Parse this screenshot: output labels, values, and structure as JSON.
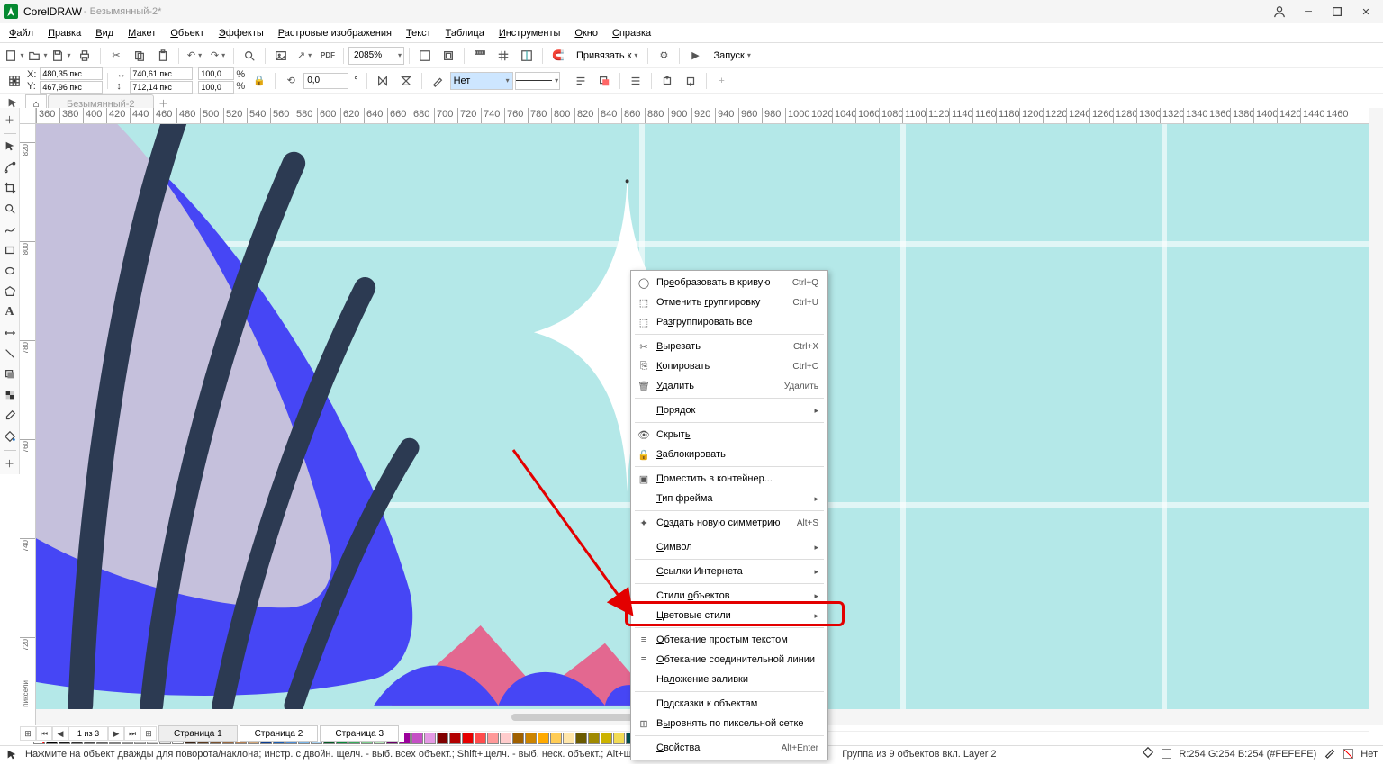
{
  "title": {
    "app": "CorelDRAW",
    "doc": " - Безымянный-2*"
  },
  "menus": [
    "Файл",
    "Правка",
    "Вид",
    "Макет",
    "Объект",
    "Эффекты",
    "Растровые изображения",
    "Текст",
    "Таблица",
    "Инструменты",
    "Окно",
    "Справка"
  ],
  "toolbar1": {
    "zoom": "2085%",
    "snap_label": "Привязать к",
    "launch_label": "Запуск"
  },
  "property_bar": {
    "x_label": "X:",
    "x": "480,35 пкс",
    "y_label": "Y:",
    "y": "467,96 пкс",
    "w": "740,61 пкс",
    "h": "712,14 пкс",
    "sx": "100,0",
    "sy": "100,0",
    "pct": "%",
    "angle": "0,0",
    "deg": "°",
    "outline": "Нет"
  },
  "doc_tabs": {
    "home": "⌂",
    "tab1": "Безымянный-2",
    "add": "+"
  },
  "ruler": {
    "unit": "пиксели",
    "h_ticks": [
      360,
      380,
      400,
      420,
      440,
      460,
      480,
      500,
      520,
      540,
      560,
      580,
      600,
      620,
      640,
      660,
      680,
      700,
      720,
      740,
      760,
      780,
      800,
      820,
      840,
      860,
      880,
      900,
      920,
      940,
      960,
      980,
      1000,
      1020,
      1040,
      1060,
      1080,
      1100,
      1120,
      1140,
      1160,
      1180,
      1200,
      1220,
      1240,
      1260,
      1280,
      1300,
      1320,
      1340,
      1360,
      1380,
      1400,
      1420,
      1440,
      1460
    ],
    "v_ticks": [
      820,
      800,
      780,
      760,
      740,
      720
    ]
  },
  "page_nav": {
    "info": "1 из 3",
    "tabs": [
      "Страница 1",
      "Страница 2",
      "Страница 3"
    ]
  },
  "palette": [
    "#000000",
    "#1a1a1a",
    "#333333",
    "#4d4d4d",
    "#666666",
    "#808080",
    "#999999",
    "#b3b3b3",
    "#cccccc",
    "#e6e6e6",
    "#ffffff",
    "#3b2314",
    "#5b3a1e",
    "#7a5230",
    "#9a6a42",
    "#b98355",
    "#d2a679",
    "#0b3d91",
    "#1e5fb3",
    "#4f8fd6",
    "#7ab6e8",
    "#a8d1f0",
    "#065c27",
    "#0c8a3b",
    "#3aad5d",
    "#7fd18f",
    "#b8e8bb",
    "#6a006a",
    "#9b009b",
    "#c550c5",
    "#e49ae4",
    "#800000",
    "#b30000",
    "#e60000",
    "#ff4d4d",
    "#ff9999",
    "#ffcccc",
    "#a06000",
    "#cc8400",
    "#ffaa00",
    "#ffcc55",
    "#ffe6aa",
    "#6a5a00",
    "#a08a00",
    "#ccb300",
    "#f2db55",
    "#004d4d",
    "#009999",
    "#55cccc",
    "#aae6e6",
    "#2d004d",
    "#52008a",
    "#8a3fc7",
    "#c49ce8"
  ],
  "context_menu": [
    {
      "icon": "convert",
      "label": "Пр<u>е</u>образовать в кривую",
      "shortcut": "Ctrl+Q"
    },
    {
      "icon": "ungroup",
      "label": "Отменить <u>г</u>руппировку",
      "shortcut": "Ctrl+U"
    },
    {
      "icon": "ungroup-all",
      "label": "Ра<u>з</u>группировать все"
    },
    {
      "sep": true
    },
    {
      "icon": "cut",
      "label": "<u>В</u>ырезать",
      "shortcut": "Ctrl+X"
    },
    {
      "icon": "copy",
      "label": "<u>К</u>опировать",
      "shortcut": "Ctrl+C"
    },
    {
      "icon": "delete",
      "label": "<u>У</u>далить",
      "shortcut": "Удалить"
    },
    {
      "sep": true
    },
    {
      "label": "<u>П</u>орядок",
      "sub": true
    },
    {
      "sep": true
    },
    {
      "icon": "hide",
      "label": "Скрыт<u>ь</u>"
    },
    {
      "icon": "lock",
      "label": "<u>З</u>аблокировать"
    },
    {
      "sep": true
    },
    {
      "icon": "container",
      "label": "<u>П</u>оместить в контейнер..."
    },
    {
      "label": "<u>Т</u>ип фрейма",
      "sub": true
    },
    {
      "sep": true
    },
    {
      "icon": "symmetry",
      "label": "С<u>о</u>здать новую симметрию",
      "shortcut": "Alt+S"
    },
    {
      "sep": true
    },
    {
      "label": "<u>С</u>имвол",
      "sub": true
    },
    {
      "sep": true
    },
    {
      "label": "<u>С</u>сылки Интернета",
      "sub": true
    },
    {
      "sep": true
    },
    {
      "label": "Стили <u>о</u>бъектов",
      "sub": true
    },
    {
      "label": "<u>Ц</u>ветовые стили",
      "sub": true
    },
    {
      "sep": true
    },
    {
      "icon": "wrap",
      "label": "<u>О</u>бтекание простым текстом"
    },
    {
      "icon": "wrap2",
      "label": "<u>О</u>бтекание соединительной линии"
    },
    {
      "label": "На<u>л</u>ожение заливки",
      "highlighted": true
    },
    {
      "sep": true
    },
    {
      "label": "П<u>о</u>дсказки к объектам"
    },
    {
      "icon": "pixel",
      "label": "В<u>ы</u>ровнять по пиксельной сетке"
    },
    {
      "sep": true
    },
    {
      "label": "<u>С</u>войства",
      "shortcut": "Alt+Enter"
    }
  ],
  "status": {
    "hint": "Нажмите на объект дважды для поворота/наклона; инстр. с двойн. щелч. - выб. всех объект.; Shift+щелч. - выб. неск. объект.; Alt+щелч. - цифры; Ctrl+щелч. - выб. в группе",
    "selection": "Группа из 9 объектов вкл. Layer 2",
    "fill": "R:254 G:254 B:254 (#FEFEFE)",
    "outline": "Нет",
    "outline_label": "⊘"
  }
}
